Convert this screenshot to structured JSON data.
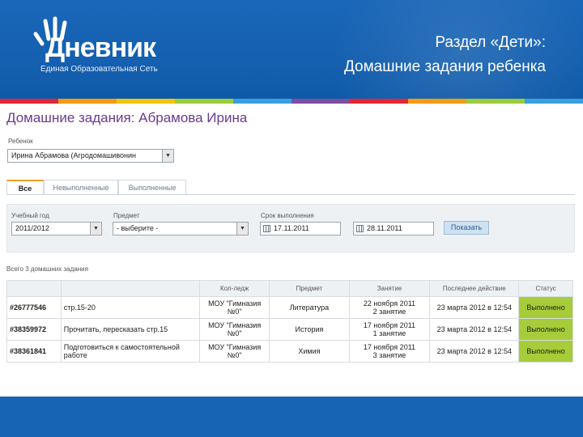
{
  "colors": {
    "header": "#1764b4",
    "accent": "#6b3a8f",
    "status_done": "#a6cc3a",
    "stripe": [
      "#e32636",
      "#f39c12",
      "#f1c40f",
      "#9ccc3a",
      "#3aa0dc",
      "#7b4ea0",
      "#e32636",
      "#f39c12",
      "#9ccc3a",
      "#3aa0dc"
    ]
  },
  "logo": {
    "name": "Дневник",
    "subtitle": "Единая Образовательная Сеть"
  },
  "slide_title": {
    "line1": "Раздел «Дети»:",
    "line2": "Домашние задания ребенка"
  },
  "page_title": "Домашние задания: Абрамова Ирина",
  "child_label": "Ребенок",
  "child_select": "Ирина Абрамова (Агродомашивонин",
  "tabs": [
    {
      "label": "Все",
      "active": true
    },
    {
      "label": "Невыполненные",
      "active": false
    },
    {
      "label": "Выполненные",
      "active": false
    }
  ],
  "filters": {
    "year_label": "Учебный год",
    "year_value": "2011/2012",
    "subject_label": "Предмет",
    "subject_value": "- выберите -",
    "due_label": "Срок выполнения",
    "date_from": "17.11.2011",
    "date_to": "28.11.2011",
    "show_button": "Показать"
  },
  "total": "Всего 3 домашних задания",
  "table": {
    "headers": [
      "",
      "",
      "Кол-ледж",
      "Предмет",
      "Занятие",
      "Последнее действие",
      "Статус"
    ],
    "rows": [
      {
        "id": "#26777546",
        "task": "стр.15-20",
        "school": "МОУ \"Гимназия №0\"",
        "subject": "Литература",
        "lesson_date": "22 ноября 2011",
        "lesson_num": "2 занятие",
        "last_action": "23 марта 2012 в 12:54",
        "status": "Выполнено"
      },
      {
        "id": "#38359972",
        "task": "Прочитать, пересказать стр.15",
        "school": "МОУ \"Гимназия №0\"",
        "subject": "История",
        "lesson_date": "17 ноября 2011",
        "lesson_num": "1 занятие",
        "last_action": "23 марта 2012 в 12:54",
        "status": "Выполнено"
      },
      {
        "id": "#38361841",
        "task": "Подготовиться к самостоятельной работе",
        "school": "МОУ \"Гимназия №0\"",
        "subject": "Химия",
        "lesson_date": "17 ноября 2011",
        "lesson_num": "3 занятие",
        "last_action": "23 марта 2012 в 12:54",
        "status": "Выполнено"
      }
    ]
  }
}
